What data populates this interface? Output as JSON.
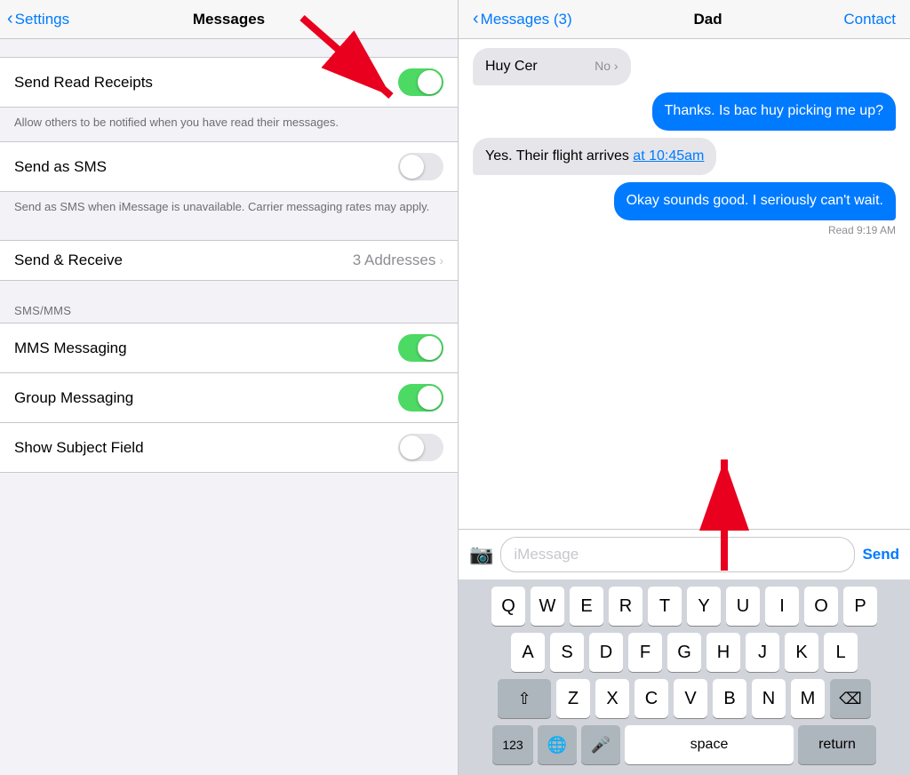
{
  "settings": {
    "back_label": "Settings",
    "title": "Messages",
    "rows": [
      {
        "id": "send-read-receipts",
        "label": "Send Read Receipts",
        "toggle": true,
        "state": "on",
        "description": "Allow others to be notified when you have read their messages."
      },
      {
        "id": "send-as-sms",
        "label": "Send as SMS",
        "toggle": true,
        "state": "off",
        "description": "Send as SMS when iMessage is unavailable. Carrier messaging rates may apply."
      },
      {
        "id": "send-receive",
        "label": "Send & Receive",
        "toggle": false,
        "value": "3 Addresses",
        "chevron": true
      }
    ],
    "sms_section_label": "SMS/MMS",
    "sms_rows": [
      {
        "id": "mms-messaging",
        "label": "MMS Messaging",
        "toggle": true,
        "state": "on"
      },
      {
        "id": "group-messaging",
        "label": "Group Messaging",
        "toggle": true,
        "state": "on"
      },
      {
        "id": "show-subject-field",
        "label": "Show Subject Field",
        "toggle": true,
        "state": "off"
      }
    ]
  },
  "messages": {
    "back_label": "Messages (3)",
    "contact_name": "Dad",
    "contact_btn": "Contact",
    "bubbles": [
      {
        "id": "bubble-1",
        "type": "received",
        "text": "Huy Cer",
        "partial": true
      },
      {
        "id": "bubble-2",
        "type": "sent",
        "text": "Thanks. Is bac huy picking me up?"
      },
      {
        "id": "bubble-3",
        "type": "received",
        "text_parts": [
          {
            "text": "Yes. Their flight arrives "
          },
          {
            "text": "at 10:45am",
            "link": true
          }
        ]
      },
      {
        "id": "bubble-4",
        "type": "sent",
        "text": "Okay sounds good. I seriously can't wait."
      }
    ],
    "read_receipt": "Read 9:19 AM",
    "input_placeholder": "iMessage",
    "send_label": "Send",
    "keyboard": {
      "row1": [
        "Q",
        "W",
        "E",
        "R",
        "T",
        "Y",
        "U",
        "I",
        "O",
        "P"
      ],
      "row2": [
        "A",
        "S",
        "D",
        "F",
        "G",
        "H",
        "J",
        "K",
        "L"
      ],
      "row3": [
        "Z",
        "X",
        "C",
        "V",
        "B",
        "N",
        "M"
      ],
      "bottom": {
        "num": "123",
        "space": "space",
        "return": "return"
      }
    }
  }
}
